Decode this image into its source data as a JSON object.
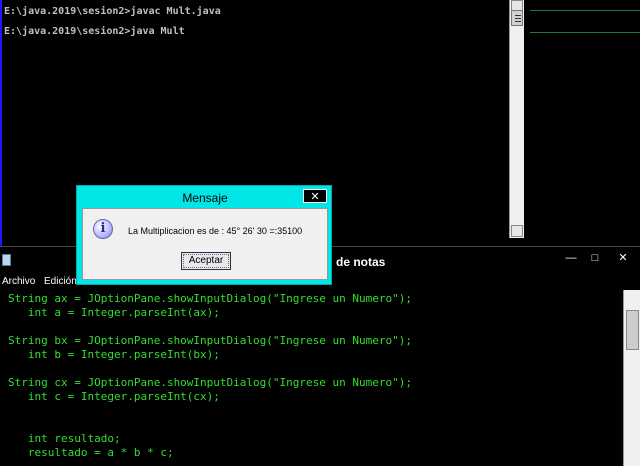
{
  "console": {
    "lines": [
      "E:\\java.2019\\sesion2>javac Mult.java",
      "E:\\java.2019\\sesion2>java Mult"
    ]
  },
  "notepad": {
    "title_partial": "de notas",
    "window_buttons": {
      "minimize": "—",
      "maximize": "□",
      "close": "✕"
    },
    "menu": [
      "Archivo",
      "Edición"
    ],
    "code_lines": [
      "String ax = JOptionPane.showInputDialog(\"Ingrese un Numero\");",
      "   int a = Integer.parseInt(ax);",
      "",
      "String bx = JOptionPane.showInputDialog(\"Ingrese un Numero\");",
      "   int b = Integer.parseInt(bx);",
      "",
      "String cx = JOptionPane.showInputDialog(\"Ingrese un Numero\");",
      "   int c = Integer.parseInt(cx);",
      "",
      "",
      "   int resultado;",
      "   resultado = a * b * c;"
    ]
  },
  "dialog": {
    "title": "Mensaje",
    "close_label": "✕",
    "icon_glyph": "i",
    "message": "La Multiplicacion es de : 45° 26' 30 =:35100",
    "button_label": "Aceptar"
  },
  "colors": {
    "code_text": "#33dd33",
    "dialog_titlebar": "#00e6e6",
    "console_text": "#c0c0c0"
  }
}
